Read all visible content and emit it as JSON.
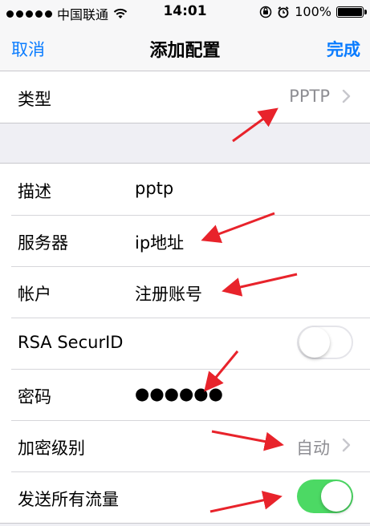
{
  "status_bar": {
    "carrier": "中国联通",
    "time": "14:01",
    "battery": "100%"
  },
  "nav": {
    "cancel": "取消",
    "title": "添加配置",
    "done": "完成"
  },
  "type_row": {
    "label": "类型",
    "value": "PPTP"
  },
  "fields": {
    "description": {
      "label": "描述",
      "value": "pptp"
    },
    "server": {
      "label": "服务器",
      "value": "ip地址"
    },
    "account": {
      "label": "帐户",
      "value": "注册账号"
    },
    "rsa": {
      "label": "RSA SecurID",
      "enabled": false
    },
    "password": {
      "label": "密码",
      "value": "●●●●●●"
    },
    "encryption": {
      "label": "加密级别",
      "value": "自动"
    },
    "send_all": {
      "label": "发送所有流量",
      "enabled": true
    }
  },
  "colors": {
    "accent": "#0a7cff",
    "toggle_on": "#4cd964",
    "annotation_arrow": "#e8232b",
    "secondary_text": "#8e8e93"
  }
}
